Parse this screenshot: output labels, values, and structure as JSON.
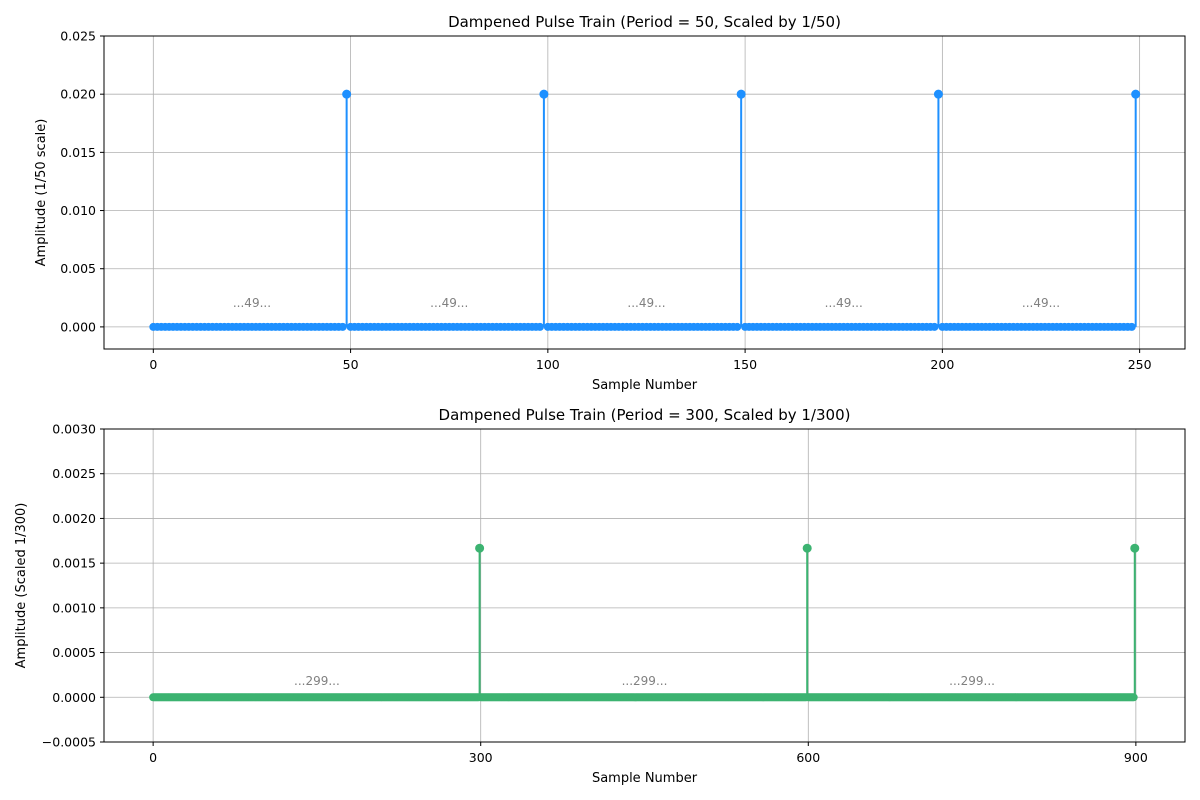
{
  "chart_data": [
    {
      "type": "stem",
      "title": "Dampened Pulse Train (Period = 50, Scaled by 1/50)",
      "xlabel": "Sample Number",
      "ylabel": "Amplitude (1/50 scale)",
      "xlim": [
        -12.5,
        261.5
      ],
      "ylim": [
        -0.0019,
        0.025
      ],
      "xticks": [
        0,
        50,
        100,
        150,
        200,
        250
      ],
      "xtick_labels": [
        "0",
        "50",
        "100",
        "150",
        "200",
        "250"
      ],
      "yticks": [
        0.0,
        0.005,
        0.01,
        0.015,
        0.02,
        0.025
      ],
      "ytick_labels": [
        "0.000",
        "0.005",
        "0.010",
        "0.015",
        "0.020",
        "0.025"
      ],
      "grid": true,
      "color": "#1e90ff",
      "n_samples": 250,
      "period": 50,
      "baseline": 0.0,
      "pulse_value": 0.02,
      "pulses": [
        {
          "x": 49,
          "y": 0.02
        },
        {
          "x": 99,
          "y": 0.02
        },
        {
          "x": 149,
          "y": 0.02
        },
        {
          "x": 199,
          "y": 0.02
        },
        {
          "x": 249,
          "y": 0.02
        }
      ],
      "annotations": [
        {
          "text": "...49...",
          "x": 25,
          "y": 0.0017
        },
        {
          "text": "...49...",
          "x": 75,
          "y": 0.0017
        },
        {
          "text": "...49...",
          "x": 125,
          "y": 0.0017
        },
        {
          "text": "...49...",
          "x": 175,
          "y": 0.0017
        },
        {
          "text": "...49...",
          "x": 225,
          "y": 0.0017
        }
      ]
    },
    {
      "type": "stem",
      "title": "Dampened Pulse Train (Period = 300, Scaled by 1/300)",
      "xlabel": "Sample Number",
      "ylabel": "Amplitude (Scaled 1/300)",
      "xlim": [
        -45,
        945
      ],
      "ylim": [
        -0.0005,
        0.003
      ],
      "xticks": [
        0,
        300,
        600,
        900
      ],
      "xtick_labels": [
        "0",
        "300",
        "600",
        "900"
      ],
      "yticks": [
        -0.0005,
        0.0,
        0.0005,
        0.001,
        0.0015,
        0.002,
        0.0025,
        0.003
      ],
      "ytick_labels": [
        "−0.0005",
        "0.0000",
        "0.0005",
        "0.0010",
        "0.0015",
        "0.0020",
        "0.0025",
        "0.0030"
      ],
      "grid": true,
      "color": "#3cb371",
      "n_samples": 900,
      "period": 300,
      "baseline": 0.0,
      "pulse_value": 0.001667,
      "pulses": [
        {
          "x": 299,
          "y": 0.001667
        },
        {
          "x": 599,
          "y": 0.001667
        },
        {
          "x": 899,
          "y": 0.001667
        }
      ],
      "annotations": [
        {
          "text": "...299...",
          "x": 150,
          "y": 0.000135
        },
        {
          "text": "...299...",
          "x": 450,
          "y": 0.000135
        },
        {
          "text": "...299...",
          "x": 750,
          "y": 0.000135
        }
      ]
    }
  ]
}
